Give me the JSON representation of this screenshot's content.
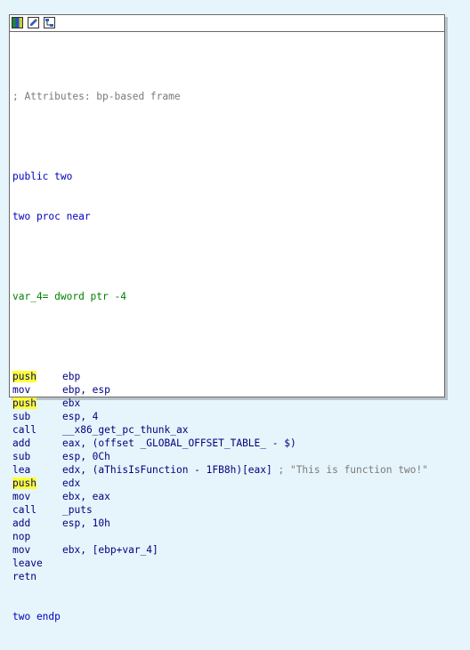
{
  "toolbar": {
    "icons": [
      "node-color-icon",
      "edit-node-icon",
      "graph-view-icon"
    ]
  },
  "lines": {
    "attributes": "; Attributes: bp-based frame",
    "public": "public two",
    "proc": "two proc near",
    "var": "var_4= dword ptr -4",
    "endp": "two endp"
  },
  "instructions": [
    {
      "mnem": "push",
      "ops": "ebp",
      "highlight": true
    },
    {
      "mnem": "mov",
      "ops": "ebp, esp",
      "highlight": false
    },
    {
      "mnem": "push",
      "ops": "ebx",
      "highlight": true
    },
    {
      "mnem": "sub",
      "ops": "esp, 4",
      "highlight": false
    },
    {
      "mnem": "call",
      "ops": "__x86_get_pc_thunk_ax",
      "highlight": false
    },
    {
      "mnem": "add",
      "ops": "eax, (offset _GLOBAL_OFFSET_TABLE_ - $)",
      "highlight": false
    },
    {
      "mnem": "sub",
      "ops": "esp, 0Ch",
      "highlight": false
    },
    {
      "mnem": "lea",
      "ops": "edx, (aThisIsFunction - 1FB8h)[eax]",
      "comment": " ; \"This is function two!\"",
      "highlight": false
    },
    {
      "mnem": "push",
      "ops": "edx",
      "highlight": true
    },
    {
      "mnem": "mov",
      "ops": "ebx, eax",
      "highlight": false
    },
    {
      "mnem": "call",
      "ops": "_puts",
      "highlight": false
    },
    {
      "mnem": "add",
      "ops": "esp, 10h",
      "highlight": false
    },
    {
      "mnem": "nop",
      "ops": "",
      "highlight": false
    },
    {
      "mnem": "mov",
      "ops": "ebx, [ebp+var_4]",
      "highlight": false
    },
    {
      "mnem": "leave",
      "ops": "",
      "highlight": false
    },
    {
      "mnem": "retn",
      "ops": "",
      "highlight": false
    }
  ],
  "colors": {
    "background": "#e6f5fb",
    "highlight": "#ffff33",
    "code": "#00007f",
    "comment": "#7a7a7a"
  }
}
